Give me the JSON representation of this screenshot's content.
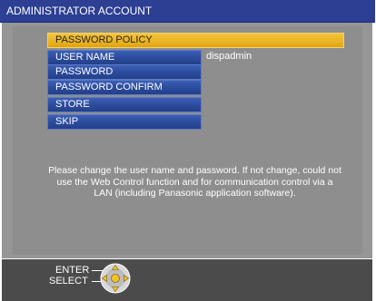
{
  "window": {
    "title": "ADMINISTRATOR ACCOUNT"
  },
  "menu": {
    "items": [
      {
        "label": "PASSWORD POLICY",
        "state": "highlighted"
      },
      {
        "label": "USER NAME",
        "value": "dispadmin"
      },
      {
        "label": "PASSWORD"
      },
      {
        "label": "PASSWORD CONFIRM"
      },
      {
        "label": "STORE"
      },
      {
        "label": "SKIP"
      }
    ]
  },
  "message": {
    "text": "Please change the user name and password. If not change, could not use the Web Control function and for communication control via a LAN (including Panasonic application software)."
  },
  "footer": {
    "enter_label": "ENTER",
    "select_label": "SELECT",
    "icon": "dpad-icon"
  },
  "colors": {
    "title_bar": "#2c3f92",
    "panel": "#969696",
    "highlight": "#e9b322",
    "menu_item": "#2c4c9e",
    "footer": "#4b4b4b"
  }
}
